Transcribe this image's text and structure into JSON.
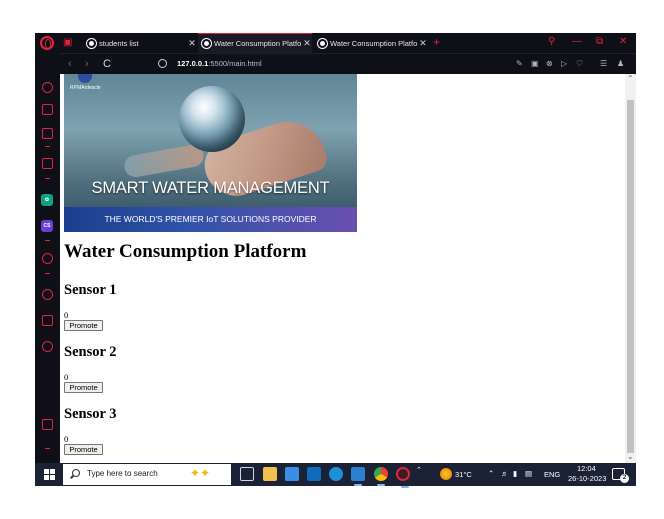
{
  "browser": {
    "tabs": [
      {
        "label": "students list",
        "active": false
      },
      {
        "label": "Water Consumption Platfo",
        "active": true
      },
      {
        "label": "Water Consumption Platfo",
        "active": false
      }
    ],
    "url_host": "127.0.0.1",
    "url_path": ":5500/main.html"
  },
  "banner": {
    "logo_text": "RPMArdescte",
    "title": "SMART WATER MANAGEMENT",
    "subtitle": "THE WORLD'S PREMIER IoT SOLUTIONS PROVIDER"
  },
  "page": {
    "heading": "Water Consumption Platform",
    "sensors": [
      {
        "name": "Sensor 1",
        "value": "0",
        "button": "Promote"
      },
      {
        "name": "Sensor 2",
        "value": "0",
        "button": "Promote"
      },
      {
        "name": "Sensor 3",
        "value": "0",
        "button": "Promote"
      }
    ]
  },
  "taskbar": {
    "search_placeholder": "Type here to search",
    "temperature": "31°C",
    "language": "ENG",
    "time": "12:04",
    "date": "26-10-2023",
    "notification_count": "2"
  },
  "colors": {
    "opera_red": "#e0243a",
    "browser_chrome": "#0f0f17",
    "taskbar": "#1c2236"
  }
}
